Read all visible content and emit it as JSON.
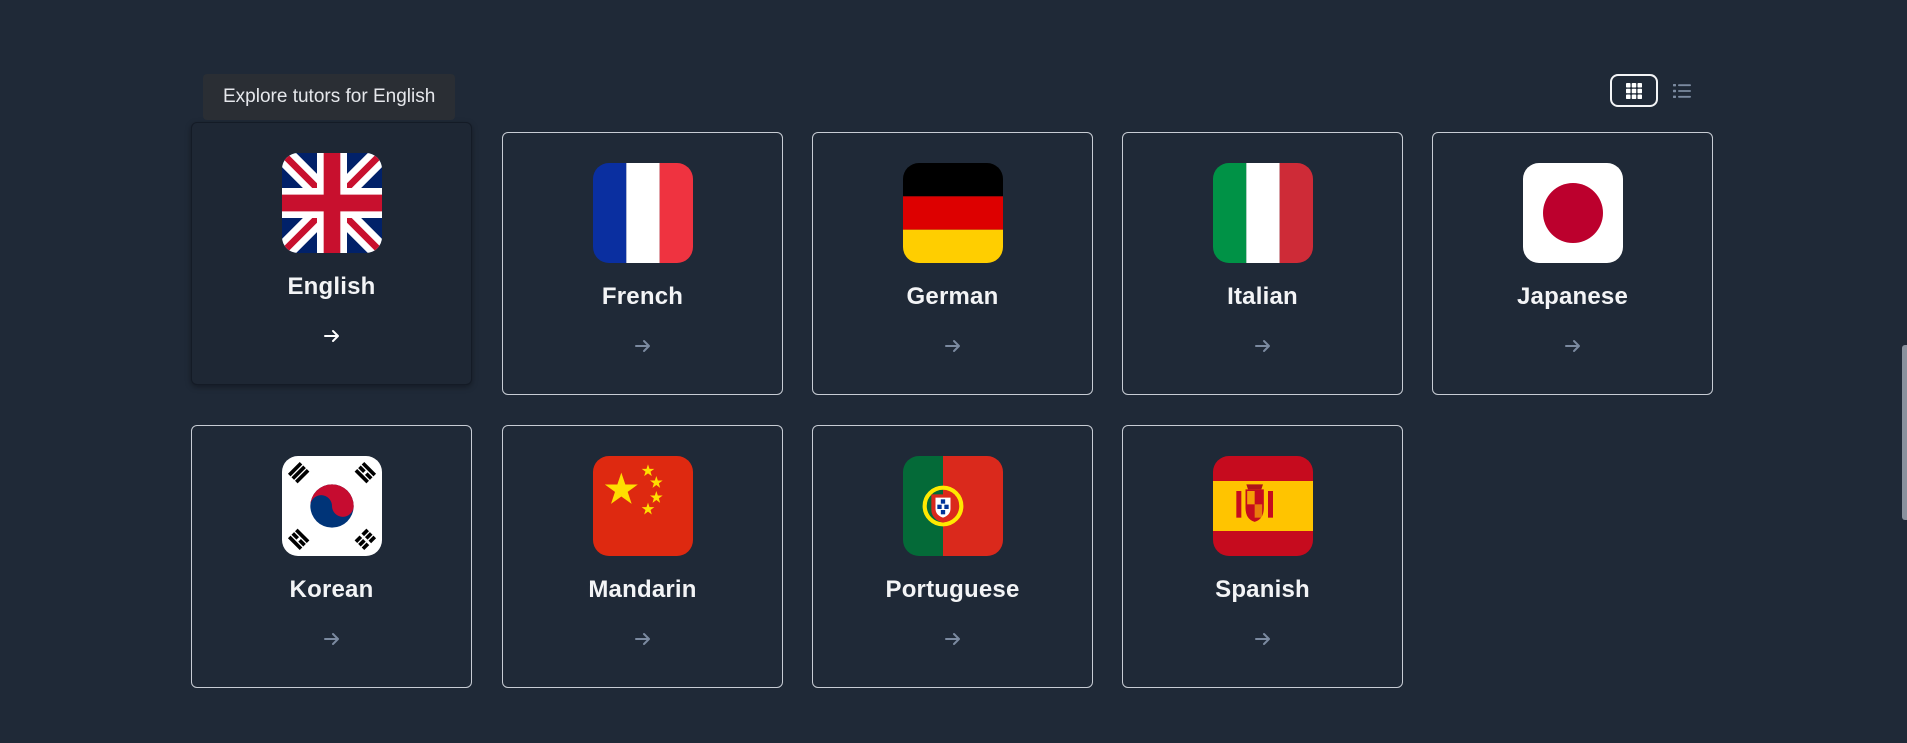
{
  "tooltip": {
    "text": "Explore tutors for English"
  },
  "view_toggle": {
    "active": "grid",
    "buttons": [
      {
        "name": "grid-view-button",
        "icon": "grid-icon"
      },
      {
        "name": "list-view-button",
        "icon": "list-icon"
      }
    ]
  },
  "languages": [
    {
      "name": "English",
      "flag": "uk-flag-icon",
      "hovered": true
    },
    {
      "name": "French",
      "flag": "france-flag-icon"
    },
    {
      "name": "German",
      "flag": "germany-flag-icon"
    },
    {
      "name": "Italian",
      "flag": "italy-flag-icon"
    },
    {
      "name": "Japanese",
      "flag": "japan-flag-icon"
    },
    {
      "name": "Korean",
      "flag": "south-korea-flag-icon"
    },
    {
      "name": "Mandarin",
      "flag": "china-flag-icon"
    },
    {
      "name": "Portuguese",
      "flag": "portugal-flag-icon"
    },
    {
      "name": "Spanish",
      "flag": "spain-flag-icon"
    }
  ],
  "colors": {
    "background": "#1f2937",
    "card_border": "#c7ccd4",
    "text": "#f3f4f6",
    "arrow_muted": "#7b8aa0",
    "arrow_active": "#ffffff"
  }
}
